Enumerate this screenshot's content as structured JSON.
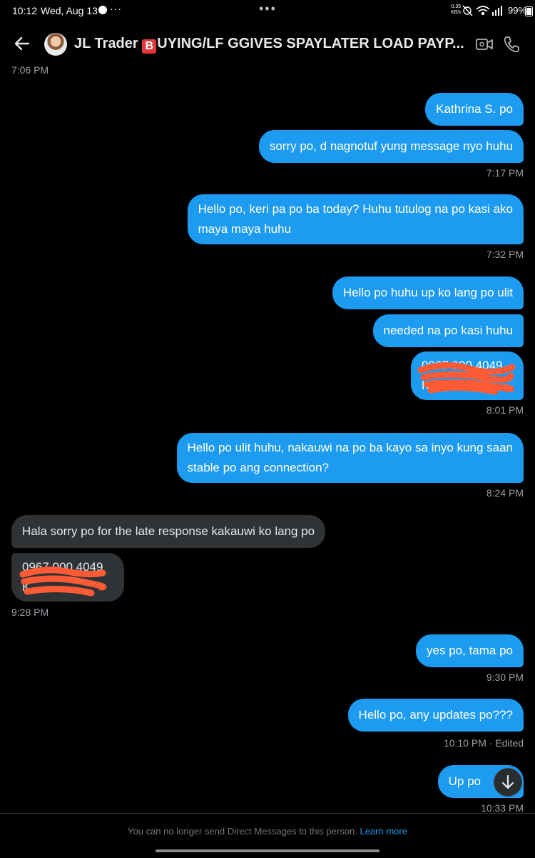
{
  "status_bar": {
    "time": "10:12",
    "date": "Wed, Aug 13",
    "net_speed_value": "0.35",
    "net_speed_unit": "KB/s",
    "battery": "99"
  },
  "header": {
    "name": "JL Trader",
    "badge": "B",
    "title_rest": "UYING/LF GGIVES SPAYLATER LOAD PAYP..."
  },
  "messages": {
    "t_706": "7:06 PM",
    "m1": "Kathrina S. po",
    "m2": "sorry po, d nagnotuf yung message nyo huhu",
    "t_717": "7:17 PM",
    "m3_l1": "Hello po, keri pa po ba today? Huhu tutulog na po kasi ako",
    "m3_l2": "maya maya huhu",
    "t_732": "7:32 PM",
    "m4": "Hello po huhu up ko lang po ulit",
    "m5": "needed na po kasi huhu",
    "m6_l1": "0967 000 4049",
    "m6_l2": "Ka...",
    "t_801": "8:01 PM",
    "m7_l1": "Hello po ulit huhu, nakauwi na po ba kayo sa inyo kung saan",
    "m7_l2": "stable po ang connection?",
    "t_824": "8:24 PM",
    "r1": "Hala sorry po for the late response kakauwi ko lang po",
    "r2_l1": "0967 000 4049",
    "r2_l2": "K...",
    "t_928": "9:28 PM",
    "m8": "yes po, tama po",
    "t_930": "9:30 PM",
    "m9": "Hello po, any updates po???",
    "t_1010": "10:10 PM · Edited",
    "m10": "Up po",
    "t_1033": "10:33 PM"
  },
  "footer": {
    "notice": "You can no longer send Direct Messages to this person.",
    "learn_more": "Learn more"
  },
  "colors": {
    "background": "#000000",
    "outgoing_bubble": "#1d9bf0",
    "incoming_bubble": "#2f3336",
    "redaction": "#ff5a36"
  },
  "icons": [
    "back-arrow-icon",
    "video-call-icon",
    "phone-icon",
    "arrow-down-icon",
    "messenger-icon",
    "wifi-icon",
    "battery-icon",
    "alarm-off-icon"
  ]
}
